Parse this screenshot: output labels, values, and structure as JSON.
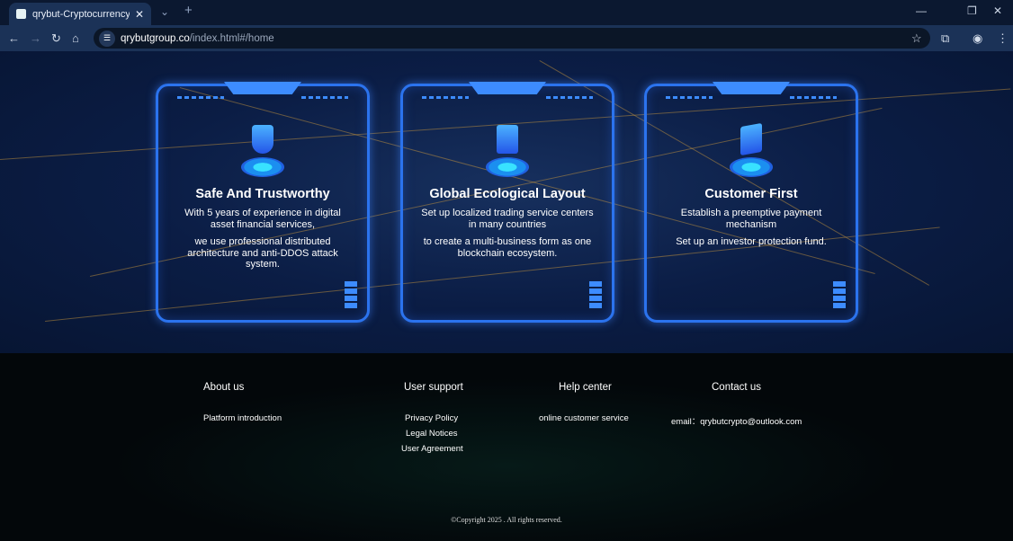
{
  "browser": {
    "tab_title": "qrybut-Cryptocurrency exchange",
    "url_host": "qrybutgroup.co",
    "url_path": "/index.html#/home"
  },
  "cards": [
    {
      "title": "Safe And Trustworthy",
      "icon": "shield-icon",
      "lines": [
        "With 5 years of experience in digital asset financial services,",
        "we use professional distributed architecture and anti-DDOS attack system."
      ]
    },
    {
      "title": "Global Ecological Layout",
      "icon": "building-icon",
      "lines": [
        "Set up localized trading service centers in many countries",
        "to create a multi-business form as one blockchain ecosystem."
      ]
    },
    {
      "title": "Customer First",
      "icon": "cards-icon",
      "lines": [
        "Establish a preemptive payment mechanism",
        "Set up an investor protection fund."
      ]
    }
  ],
  "footer": {
    "about": {
      "heading": "About us",
      "links": [
        "Platform introduction"
      ]
    },
    "support": {
      "heading": "User support",
      "links": [
        "Privacy Policy",
        "Legal Notices",
        "User Agreement"
      ]
    },
    "help": {
      "heading": "Help center",
      "links": [
        "online customer service"
      ]
    },
    "contact": {
      "heading": "Contact us",
      "email": "email：qrybutcrypto@outlook.com"
    },
    "copyright": "©Copyright 2025 . All rights reserved."
  },
  "colors": {
    "accent": "#3d8cff",
    "hero_bg": "#0b1d45",
    "footer_bg": "#03070a"
  }
}
